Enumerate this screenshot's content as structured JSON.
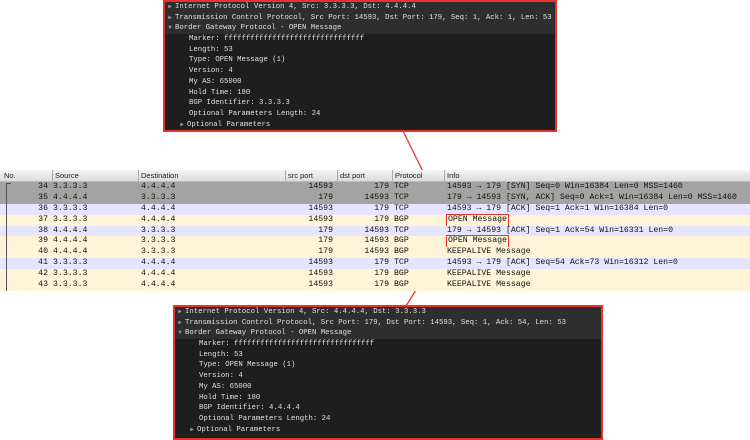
{
  "top_panel": {
    "lines": [
      "Internet Protocol Version 4, Src: 3.3.3.3, Dst: 4.4.4.4",
      "Transmission Control Protocol, Src Port: 14593, Dst Port: 179, Seq: 1, Ack: 1, Len: 53",
      "Border Gateway Protocol - OPEN Message"
    ],
    "fields": [
      "Marker: ffffffffffffffffffffffffffffffff",
      "Length: 53",
      "Type: OPEN Message (1)",
      "Version: 4",
      "My AS: 65000",
      "Hold Time: 180",
      "BGP Identifier: 3.3.3.3",
      "Optional Parameters Length: 24"
    ],
    "optional": "Optional Parameters"
  },
  "table": {
    "headers": [
      "No.",
      "Source",
      "Destination",
      "src port",
      "dst port",
      "Protocol",
      "Info"
    ],
    "rows": [
      {
        "no": "34",
        "src": "3.3.3.3",
        "dst": "4.4.4.4",
        "sp": "14593",
        "dp": "179",
        "proto": "TCP",
        "info": "14593 → 179 [SYN] Seq=0 Win=16384 Len=0 MSS=1460"
      },
      {
        "no": "35",
        "src": "4.4.4.4",
        "dst": "3.3.3.3",
        "sp": "179",
        "dp": "14593",
        "proto": "TCP",
        "info": "179 → 14593 [SYN, ACK] Seq=0 Ack=1 Win=16384 Len=0 MSS=1460"
      },
      {
        "no": "36",
        "src": "3.3.3.3",
        "dst": "4.4.4.4",
        "sp": "14593",
        "dp": "179",
        "proto": "TCP",
        "info": "14593 → 179 [ACK] Seq=1 Ack=1 Win=16384 Len=0"
      },
      {
        "no": "37",
        "src": "3.3.3.3",
        "dst": "4.4.4.4",
        "sp": "14593",
        "dp": "179",
        "proto": "BGP",
        "info": "OPEN Message"
      },
      {
        "no": "38",
        "src": "4.4.4.4",
        "dst": "3.3.3.3",
        "sp": "179",
        "dp": "14593",
        "proto": "TCP",
        "info": "179 → 14593 [ACK] Seq=1 Ack=54 Win=16331 Len=0"
      },
      {
        "no": "39",
        "src": "4.4.4.4",
        "dst": "3.3.3.3",
        "sp": "179",
        "dp": "14593",
        "proto": "BGP",
        "info": "OPEN Message"
      },
      {
        "no": "40",
        "src": "4.4.4.4",
        "dst": "3.3.3.3",
        "sp": "179",
        "dp": "14593",
        "proto": "BGP",
        "info": "KEEPALIVE Message"
      },
      {
        "no": "41",
        "src": "3.3.3.3",
        "dst": "4.4.4.4",
        "sp": "14593",
        "dp": "179",
        "proto": "TCP",
        "info": "14593 → 179 [ACK] Seq=54 Ack=73 Win=16312 Len=0"
      },
      {
        "no": "42",
        "src": "3.3.3.3",
        "dst": "4.4.4.4",
        "sp": "14593",
        "dp": "179",
        "proto": "BGP",
        "info": "KEEPALIVE Message"
      },
      {
        "no": "43",
        "src": "3.3.3.3",
        "dst": "4.4.4.4",
        "sp": "14593",
        "dp": "179",
        "proto": "BGP",
        "info": "KEEPALIVE Message"
      }
    ]
  },
  "bottom_panel": {
    "lines": [
      "Internet Protocol Version 4, Src: 4.4.4.4, Dst: 3.3.3.3",
      "Transmission Control Protocol, Src Port: 179, Dst Port: 14593, Seq: 1, Ack: 54, Len: 53",
      "Border Gateway Protocol - OPEN Message"
    ],
    "fields": [
      "Marker: ffffffffffffffffffffffffffffffff",
      "Length: 53",
      "Type: OPEN Message (1)",
      "Version: 4",
      "My AS: 65000",
      "Hold Time: 180",
      "BGP Identifier: 4.4.4.4",
      "Optional Parameters Length: 24"
    ],
    "optional": "Optional Parameters"
  },
  "colors": {
    "highlight": "#e8332a",
    "tcp_row": "#e6e5ff",
    "bgp_row": "#fff4d7",
    "selected_row": "#a3a3a3"
  }
}
